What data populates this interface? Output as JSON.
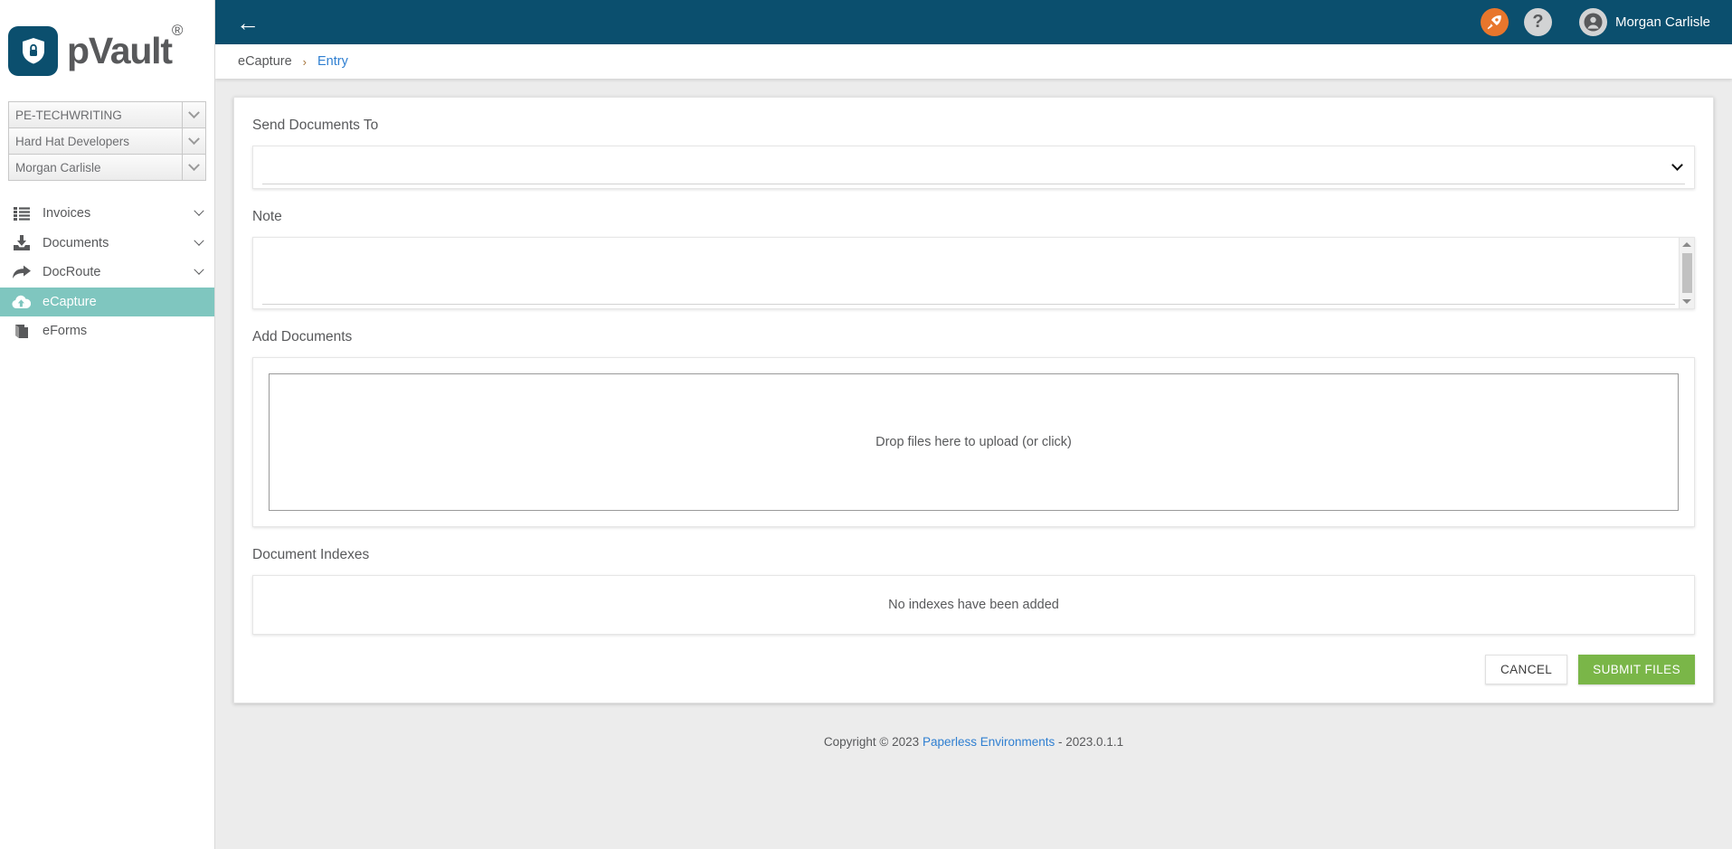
{
  "brand": {
    "name": "pVault",
    "trademark": "®",
    "logo_icon": "shield-lock-icon"
  },
  "sidebar": {
    "selectors": [
      {
        "value": "PE-TECHWRITING",
        "icon": "chevron-down-icon"
      },
      {
        "value": "Hard Hat Developers",
        "icon": "chevron-down-icon"
      },
      {
        "value": "Morgan Carlisle",
        "icon": "chevron-down-icon"
      }
    ],
    "nav": [
      {
        "label": "Invoices",
        "icon": "list-icon",
        "caret": "chevron-down-icon",
        "active": false
      },
      {
        "label": "Documents",
        "icon": "download-inbox-icon",
        "caret": "chevron-down-icon",
        "active": false
      },
      {
        "label": "DocRoute",
        "icon": "forward-arrow-icon",
        "caret": "chevron-down-icon",
        "active": false
      },
      {
        "label": "eCapture",
        "icon": "cloud-upload-icon",
        "caret": "",
        "active": true
      },
      {
        "label": "eForms",
        "icon": "book-icon",
        "caret": "",
        "active": false
      }
    ],
    "active_color": "#7fc6bf"
  },
  "topbar": {
    "back_icon": "back-arrow-icon",
    "rocket_icon": "rocket-icon",
    "help_icon": "question-mark-icon",
    "avatar_icon": "user-avatar-icon",
    "user_name": "Morgan Carlisle",
    "background": "#0b4f6e",
    "rocket_color": "#e8762c"
  },
  "breadcrumb": {
    "parent": "eCapture",
    "separator": "›",
    "current": "Entry"
  },
  "form": {
    "send_documents_to": {
      "label": "Send Documents To",
      "value": "",
      "icon": "chevron-down-icon"
    },
    "note": {
      "label": "Note",
      "value": "",
      "scroll_up_icon": "triangle-up-icon",
      "scroll_down_icon": "triangle-down-icon"
    },
    "add_documents": {
      "label": "Add Documents",
      "dropzone_text": "Drop files here to upload (or click)"
    },
    "document_indexes": {
      "label": "Document Indexes",
      "empty_text": "No indexes have been added"
    },
    "buttons": {
      "cancel": "CANCEL",
      "submit": "SUBMIT FILES",
      "submit_color": "#7ab648"
    }
  },
  "footer": {
    "copyright": "Copyright © 2023",
    "company": "Paperless Environments",
    "version": "- 2023.0.1.1"
  }
}
